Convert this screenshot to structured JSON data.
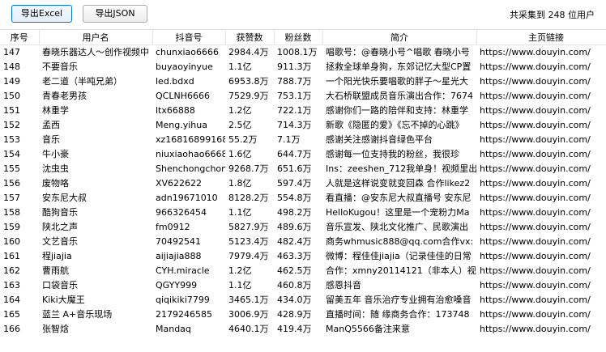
{
  "toolbar": {
    "export_excel": "导出Excel",
    "export_json": "导出JSON",
    "status": "共采集到 248 位用户"
  },
  "table": {
    "columns": [
      "序号",
      "用户名",
      "抖音号",
      "获赞数",
      "粉丝数",
      "简介",
      "主页链接"
    ],
    "rows": [
      [
        "147",
        "春晓乐器达人～创作视频中",
        "chunxiao6666",
        "2984.4万",
        "1008.1万",
        "唱歌号：@春晓小号^唱歌 春晓小号",
        "https://www.douyin.com/"
      ],
      [
        "148",
        "不要音乐",
        "buyaoyinyue",
        "1.1亿",
        "911.3万",
        "拯救全球单身狗，东郊记忆大型CP置",
        "https://www.douyin.com/"
      ],
      [
        "149",
        "老二道（半吨兄弟）",
        "led.bdxd",
        "6953.8万",
        "788.7万",
        "一个阳光快乐要唱歌的胖子～星光大",
        "https://www.douyin.com/"
      ],
      [
        "150",
        "青春老男孩",
        "QCLNH6666",
        "7529.9万",
        "753.1万",
        "大石桥联盟成员音乐演出合作：7674",
        "https://www.douyin.com/"
      ],
      [
        "151",
        "林重学",
        "ltx66888",
        "1.2亿",
        "722.1万",
        "感谢你们一路的陪伴和支持：林重学",
        "https://www.douyin.com/"
      ],
      [
        "152",
        "孟西",
        "Meng.yihua",
        "2.5亿",
        "714.3万",
        "新歌《隐匿的爱》《忘不掉的心跳》",
        "https://www.douyin.com/"
      ],
      [
        "153",
        "音乐",
        "xz16816899168",
        "55.2万",
        "7.1万",
        "感谢关注感谢抖音绿色平台",
        "https://www.douyin.com/"
      ],
      [
        "154",
        "牛小豪",
        "niuxiaohao6668",
        "1.6亿",
        "644.7万",
        "感谢每一位支持我的粉丝，我很珍",
        "https://www.douyin.com/"
      ],
      [
        "155",
        "沈虫虫",
        "Shenchongchong",
        "9268.7万",
        "651.6万",
        "Ins：zeeshen_712我单身！视频里出",
        "https://www.douyin.com/"
      ],
      [
        "156",
        "废物咯",
        "XV622622",
        "1.8亿",
        "597.4万",
        "人就是这样说变就变回森 合作likez2",
        "https://www.douyin.com/"
      ],
      [
        "157",
        "安东尼大叔",
        "adn19671010",
        "8128.2万",
        "554.8万",
        "看直播：@安东尼大叔直播号 安东尼",
        "https://www.douyin.com/"
      ],
      [
        "158",
        "酷狗音乐",
        "966326454",
        "1.1亿",
        "498.2万",
        "HelloKugou！这里是一个宠粉力Ma",
        "https://www.douyin.com/"
      ],
      [
        "159",
        "陕北之声",
        "fm0912",
        "5827.9万",
        "489.6万",
        "音乐宣发、陕北文化推广、民歌演出",
        "https://www.douyin.com/"
      ],
      [
        "160",
        "文艺音乐",
        "70492541",
        "5123.4万",
        "482.4万",
        "商务whmusic888@qq.com合作vx:",
        "https://www.douyin.com/"
      ],
      [
        "161",
        "程jiajia",
        "aijiajia888",
        "7979.4万",
        "463.3万",
        "微博：程佳佳jiajia（记录佳佳的日常",
        "https://www.douyin.com/"
      ],
      [
        "162",
        "曹雨航",
        "CYH.miracle",
        "1.2亿",
        "462.5万",
        "合作：xmny20114121（非本人）视",
        "https://www.douyin.com/"
      ],
      [
        "163",
        "口袋音乐",
        "QGYY999",
        "1.1亿",
        "460.8万",
        "感恩抖音",
        "https://www.douyin.com/"
      ],
      [
        "164",
        "Kiki大魔王",
        "qiqikiki7799",
        "3465.1万",
        "434.0万",
        "留美五年 音乐治疗专业拥有治愈嗓音",
        "https://www.douyin.com/"
      ],
      [
        "165",
        "蓝兰 A+音乐现场",
        "2179246585",
        "3006.9万",
        "428.9万",
        "直播时间：随 缘商务合作：173748",
        "https://www.douyin.com/"
      ],
      [
        "166",
        "张智焓",
        "Mandaq",
        "4640.1万",
        "419.4万",
        "ManQ5566备注来意",
        "https://www.douyin.com/"
      ]
    ]
  }
}
